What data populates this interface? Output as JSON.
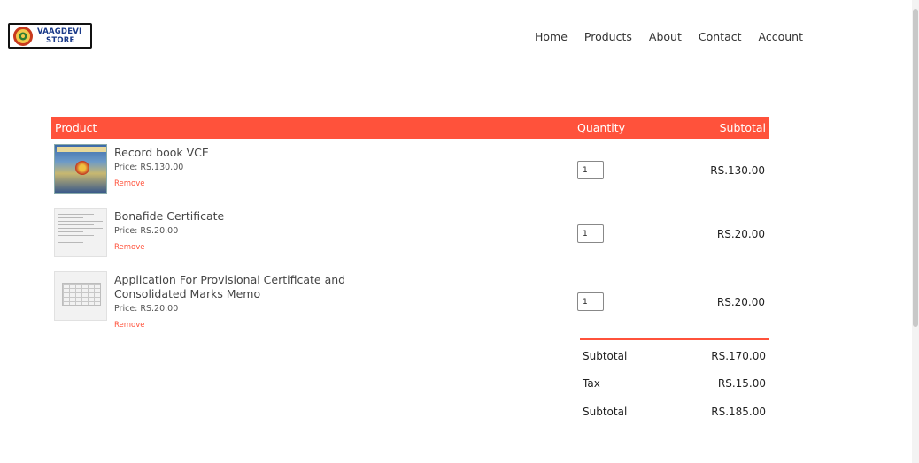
{
  "header": {
    "logo": {
      "line1": "VAAGDEVI",
      "line2": "STORE"
    },
    "nav": [
      "Home",
      "Products",
      "About",
      "Contact",
      "Account"
    ]
  },
  "cart": {
    "columns": {
      "product": "Product",
      "quantity": "Quantity",
      "subtotal": "Subtotal"
    },
    "items": [
      {
        "name": "Record book VCE",
        "price": "Price: RS.130.00",
        "remove": "Remove",
        "quantity": "1",
        "subtotal": "RS.130.00",
        "thumb_icon": "record-book-thumbnail"
      },
      {
        "name": "Bonafide Certificate",
        "price": "Price: RS.20.00",
        "remove": "Remove",
        "quantity": "1",
        "subtotal": "RS.20.00",
        "thumb_icon": "certificate-thumbnail"
      },
      {
        "name": "Application For Provisional Certificate and Consolidated Marks Memo",
        "price": "Price: RS.20.00",
        "remove": "Remove",
        "quantity": "1",
        "subtotal": "RS.20.00",
        "thumb_icon": "application-form-thumbnail"
      }
    ],
    "totals": [
      {
        "label": "Subtotal",
        "value": "RS.170.00"
      },
      {
        "label": "Tax",
        "value": "RS.15.00"
      },
      {
        "label": "Subtotal",
        "value": "RS.185.00"
      }
    ]
  },
  "colors": {
    "accent": "#ff523b",
    "logo_text": "#1a3a8a"
  }
}
